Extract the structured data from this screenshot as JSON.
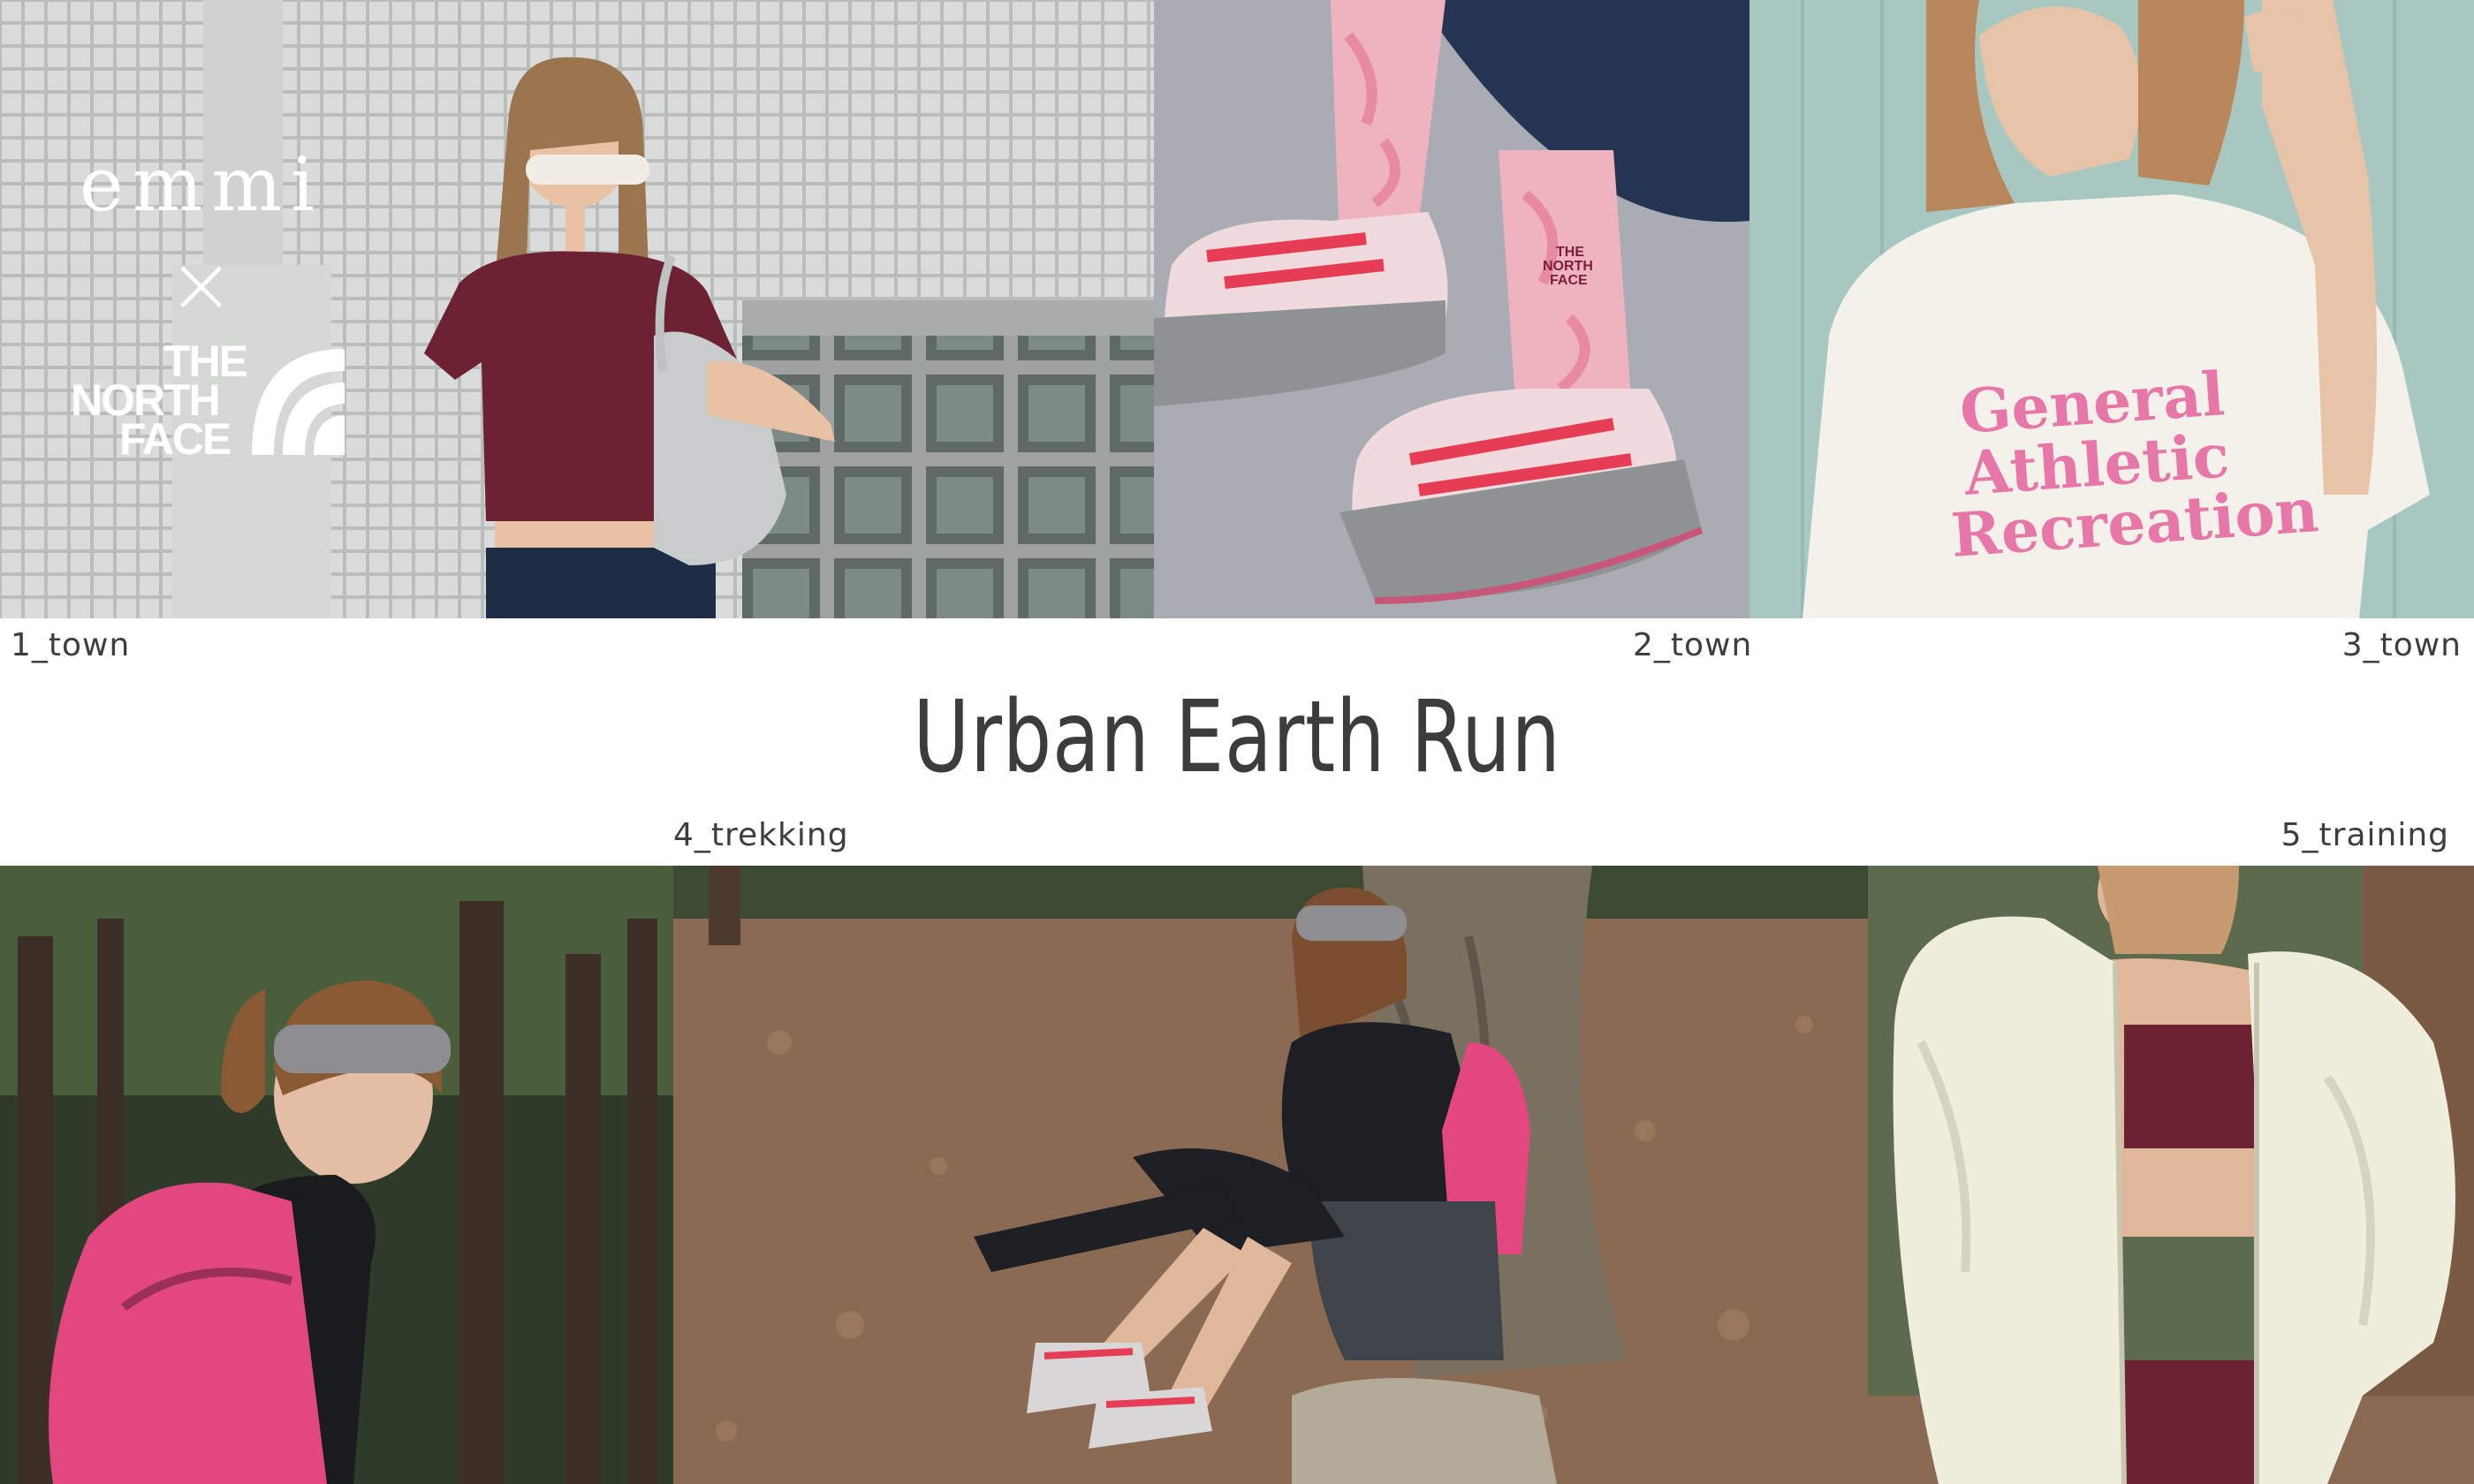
{
  "brand": {
    "collab_name": "emmi",
    "cross_symbol": "×",
    "partner_lines": [
      "THE",
      "NORTH",
      "FACE"
    ]
  },
  "title": "Urban Earth Run",
  "captions": {
    "photo1": "1_town",
    "photo2": "2_town",
    "photo3": "3_town",
    "photo4": "4_trekking",
    "photo5": "5_training"
  },
  "photos": {
    "photo1": {
      "scene": "town",
      "print": ""
    },
    "photo2": {
      "scene": "town",
      "sock_print": [
        "THE",
        "NORTH",
        "FACE"
      ]
    },
    "photo3": {
      "scene": "town",
      "shirt_print": [
        "General",
        "Athletic",
        "Recreation"
      ]
    },
    "photo4": {
      "scene": "trekking"
    },
    "photo5": {
      "scene": "trekking"
    },
    "photo6": {
      "scene": "training"
    }
  },
  "colors": {
    "background": "#ffffff",
    "text": "#3c3c3c",
    "accent_pink": "#e75c8a",
    "accent_burgundy": "#6d2233"
  }
}
